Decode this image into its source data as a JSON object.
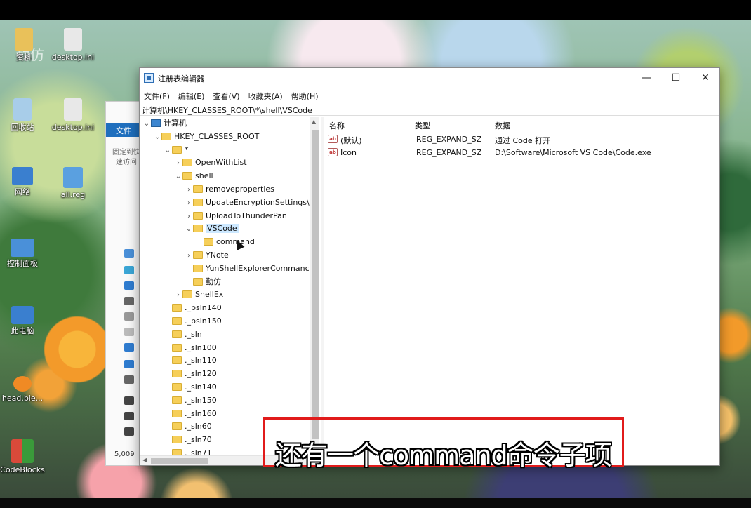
{
  "desktop": {
    "top_watermark": "勤仿",
    "icons": [
      {
        "label": "资料",
        "color": "#e9c15a"
      },
      {
        "label": "desktop.ini",
        "color": "#cccccc"
      },
      {
        "label": "回收站",
        "color": "#7fb6e6"
      },
      {
        "label": "desktop.ini",
        "color": "#cccccc"
      },
      {
        "label": "网络",
        "color": "#3a7fcf"
      },
      {
        "label": "all.reg",
        "color": "#3a7fcf"
      },
      {
        "label": "控制面板",
        "color": "#3a7fcf"
      },
      {
        "label": "此电脑",
        "color": "#3a7fcf"
      },
      {
        "label": "head.ble...",
        "color": "#f08a24"
      },
      {
        "label": "CodeBlocks",
        "color": "#d94a3a"
      }
    ]
  },
  "explorer_bg": {
    "ribbon_tab": "文件",
    "pin_text": "固定到快速访问",
    "item_count": "5,009"
  },
  "regedit": {
    "title": "注册表编辑器",
    "window_buttons": {
      "minimize": "—",
      "maximize": "☐",
      "close": "✕"
    },
    "menu": [
      "文件(F)",
      "编辑(E)",
      "查看(V)",
      "收藏夹(A)",
      "帮助(H)"
    ],
    "address": "计算机\\HKEY_CLASSES_ROOT\\*\\shell\\VSCode",
    "tree": [
      {
        "label": "计算机",
        "depth": 0,
        "expanded": true,
        "type": "pc"
      },
      {
        "label": "HKEY_CLASSES_ROOT",
        "depth": 1,
        "expanded": true
      },
      {
        "label": "*",
        "depth": 2,
        "expanded": true
      },
      {
        "label": "OpenWithList",
        "depth": 3,
        "expanded": false
      },
      {
        "label": "shell",
        "depth": 3,
        "expanded": true
      },
      {
        "label": "removeproperties",
        "depth": 4,
        "expanded": false
      },
      {
        "label": "UpdateEncryptionSettings\\",
        "depth": 4,
        "expanded": false
      },
      {
        "label": "UploadToThunderPan",
        "depth": 4,
        "expanded": false
      },
      {
        "label": "VSCode",
        "depth": 4,
        "expanded": true,
        "selected": true
      },
      {
        "label": "command",
        "depth": 5,
        "leaf": true
      },
      {
        "label": "YNote",
        "depth": 4,
        "expanded": false
      },
      {
        "label": "YunShellExplorerCommanc",
        "depth": 4,
        "leaf": true
      },
      {
        "label": "勤仿",
        "depth": 4,
        "leaf": true
      },
      {
        "label": "ShellEx",
        "depth": 3,
        "expanded": false
      },
      {
        "label": "._bsln140",
        "depth": 2,
        "leaf": true
      },
      {
        "label": "._bsln150",
        "depth": 2,
        "leaf": true
      },
      {
        "label": "._sln",
        "depth": 2,
        "leaf": true
      },
      {
        "label": "._sln100",
        "depth": 2,
        "leaf": true
      },
      {
        "label": "._sln110",
        "depth": 2,
        "leaf": true
      },
      {
        "label": "._sln120",
        "depth": 2,
        "leaf": true
      },
      {
        "label": "._sln140",
        "depth": 2,
        "leaf": true
      },
      {
        "label": "._sln150",
        "depth": 2,
        "leaf": true
      },
      {
        "label": "._sln160",
        "depth": 2,
        "leaf": true
      },
      {
        "label": "._sln60",
        "depth": 2,
        "leaf": true
      },
      {
        "label": "._sln70",
        "depth": 2,
        "leaf": true
      },
      {
        "label": "._sln71",
        "depth": 2,
        "leaf": true
      }
    ],
    "columns": {
      "name": "名称",
      "type": "类型",
      "data": "数据"
    },
    "values": [
      {
        "icon": "ab",
        "name": "(默认)",
        "type": "REG_EXPAND_SZ",
        "data": "通过 Code 打开"
      },
      {
        "icon": "ab",
        "name": "Icon",
        "type": "REG_EXPAND_SZ",
        "data": "D:\\Software\\Microsoft VS Code\\Code.exe"
      }
    ]
  },
  "caption": {
    "text": "还有一个command命令子项",
    "border_color": "#e11b1b"
  }
}
